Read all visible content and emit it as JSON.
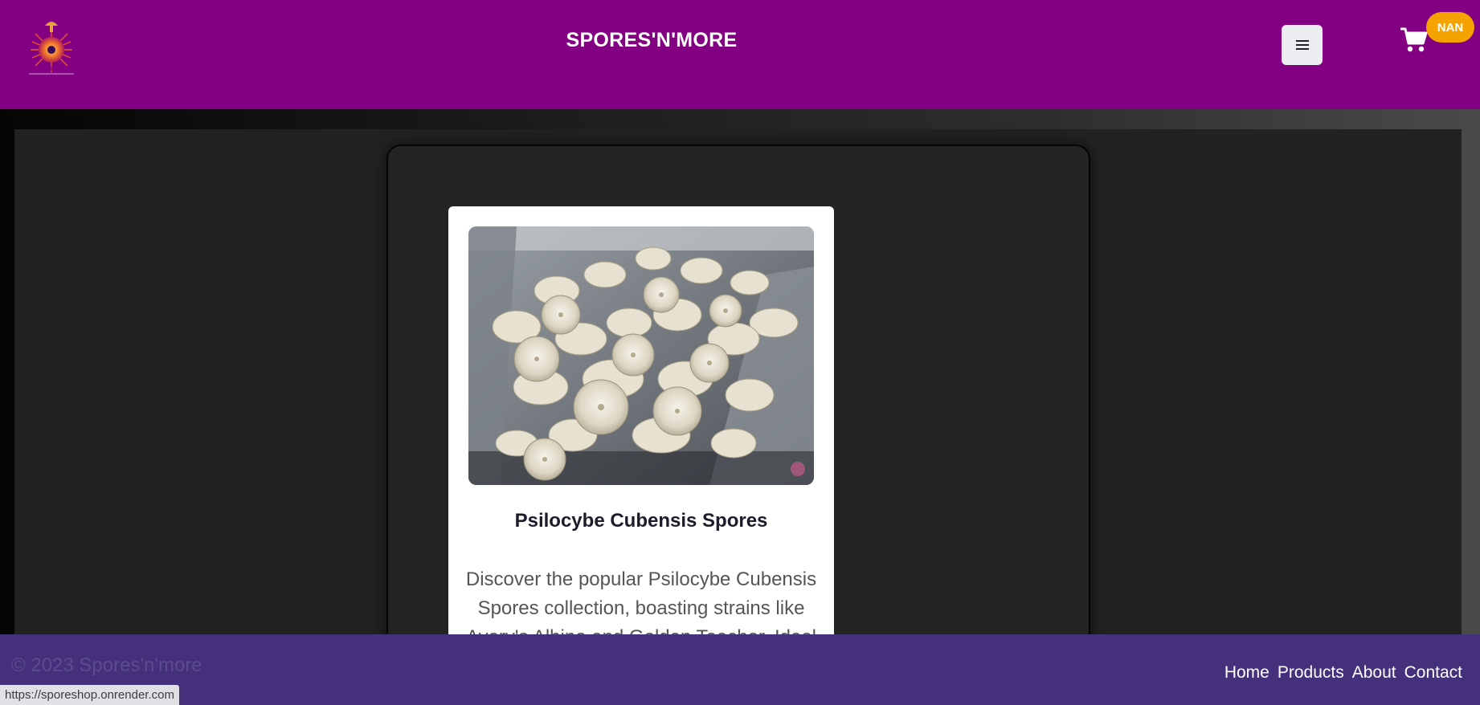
{
  "header": {
    "site_title": "SPORES'N'MORE",
    "logo_icon": "spore-sun-logo-icon",
    "menu_icon": "hamburger-menu-icon",
    "cart_icon": "shopping-cart-icon",
    "cart_badge": "NAN",
    "background_color": "#830082",
    "badge_color": "#f5a300"
  },
  "product_card": {
    "image_description_icon": "mushroom-photo",
    "title": "Psilocybe Cubensis Spores",
    "description": "Discover the popular Psilocybe Cubensis Spores collection, boasting strains like Avery's Albino and Golden Teacher. Ideal"
  },
  "footer": {
    "copyright": "© 2023 Spores'n'more",
    "nav": [
      {
        "label": "Home"
      },
      {
        "label": "Products"
      },
      {
        "label": "About"
      },
      {
        "label": "Contact"
      }
    ],
    "background_color": "#45307c"
  },
  "status_bar": {
    "url": "https://sporeshop.onrender.com"
  }
}
